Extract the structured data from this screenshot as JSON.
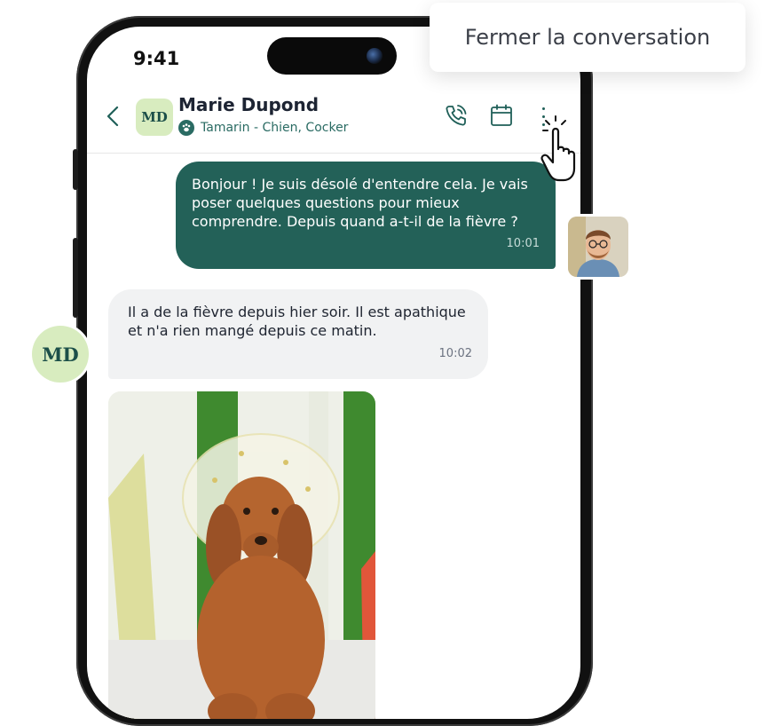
{
  "status_bar": {
    "time": "9:41"
  },
  "header": {
    "avatar_initials": "MD",
    "contact_name": "Marie Dupond",
    "pet_info": "Tamarin - Chien, Cocker"
  },
  "context_menu": {
    "item": "Fermer la conversation"
  },
  "messages": [
    {
      "direction": "outgoing",
      "text": "Bonjour ! Je suis désolé d'entendre cela. Je vais poser quelques questions pour mieux comprendre. Depuis quand a-t-il de la fièvre ?",
      "time": "10:01"
    },
    {
      "direction": "incoming",
      "text": " Il a de la fièvre depuis hier soir. Il est apathique et n'a rien mangé depuis ce matin.",
      "time": "10:02"
    }
  ],
  "incoming_avatar_initials": "MD",
  "icons": [
    "chevron-left-icon",
    "phone-icon",
    "calendar-icon",
    "more-vertical-icon",
    "paw-icon",
    "hand-pointer-icon"
  ],
  "colors": {
    "brand_green": "#236158",
    "avatar_bg": "#d8ecbf",
    "incoming_bg": "#f1f2f3"
  }
}
